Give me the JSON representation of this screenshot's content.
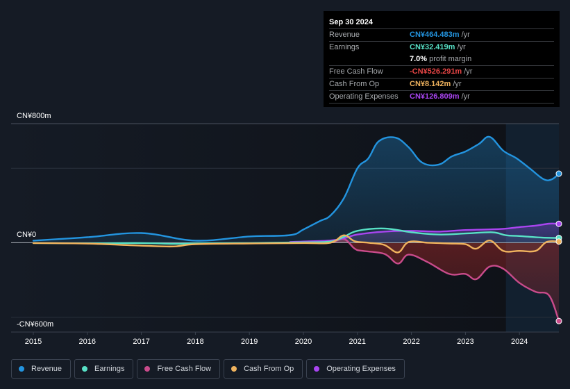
{
  "tooltip": {
    "date": "Sep 30 2024",
    "rows": [
      {
        "label": "Revenue",
        "value": "CN¥464.483m",
        "unit": "/yr",
        "color": "#2394df"
      },
      {
        "label": "Earnings",
        "value": "CN¥32.419m",
        "unit": "/yr",
        "color": "#58e1c6"
      },
      {
        "label": "",
        "value": "7.0%",
        "unit": "profit margin",
        "color": "#ffffff"
      },
      {
        "label": "Free Cash Flow",
        "value": "-CN¥526.291m",
        "unit": "/yr",
        "color": "#e64545"
      },
      {
        "label": "Cash From Op",
        "value": "CN¥8.142m",
        "unit": "/yr",
        "color": "#f0b35e"
      },
      {
        "label": "Operating Expenses",
        "value": "CN¥126.809m",
        "unit": "/yr",
        "color": "#a945f0"
      }
    ]
  },
  "legend": [
    {
      "label": "Revenue",
      "color": "#2394df"
    },
    {
      "label": "Earnings",
      "color": "#58e1c6"
    },
    {
      "label": "Free Cash Flow",
      "color": "#c94b8b"
    },
    {
      "label": "Cash From Op",
      "color": "#f0b35e"
    },
    {
      "label": "Operating Expenses",
      "color": "#a945f0"
    }
  ],
  "chart_data": {
    "type": "area",
    "title": "",
    "xlabel": "",
    "ylabel": "",
    "ylim": [
      -600,
      800
    ],
    "xlim": [
      2014.7,
      2024.75
    ],
    "y_tick_labels": [
      {
        "value": 800,
        "label": "CN¥800m"
      },
      {
        "value": 0,
        "label": "CN¥0"
      },
      {
        "value": -600,
        "label": "-CN¥600m"
      }
    ],
    "gridlines": [
      800,
      500,
      0,
      -500
    ],
    "x_ticks": [
      2015,
      2016,
      2017,
      2018,
      2019,
      2020,
      2021,
      2022,
      2023,
      2024
    ],
    "forecast_shade_start": 2023.75,
    "grid": true,
    "legend_position": "bottom-left",
    "series": [
      {
        "name": "Revenue",
        "color": "#2394df",
        "x": [
          2015.0,
          2016.0,
          2017.0,
          2018.0,
          2019.0,
          2019.75,
          2020.0,
          2020.3,
          2020.5,
          2020.75,
          2021.0,
          2021.2,
          2021.4,
          2021.7,
          2021.95,
          2022.2,
          2022.5,
          2022.75,
          2023.0,
          2023.25,
          2023.45,
          2023.7,
          2023.95,
          2024.2,
          2024.45,
          2024.6,
          2024.73
        ],
        "values": [
          14,
          37,
          65,
          14,
          42,
          51,
          89,
          145,
          182,
          299,
          500,
          566,
          683,
          706,
          641,
          538,
          524,
          580,
          613,
          664,
          711,
          618,
          566,
          496,
          426,
          426,
          464
        ]
      },
      {
        "name": "Earnings",
        "color": "#58e1c6",
        "x": [
          2015.0,
          2016.0,
          2017.0,
          2017.6,
          2018.0,
          2019.0,
          2020.0,
          2020.5,
          2020.75,
          2021.0,
          2021.5,
          2022.0,
          2022.5,
          2023.0,
          2023.5,
          2023.75,
          2024.0,
          2024.4,
          2024.73
        ],
        "values": [
          -2,
          -4,
          -2,
          -8,
          -4,
          -2,
          3,
          8,
          40,
          80,
          96,
          70,
          55,
          62,
          70,
          50,
          45,
          35,
          32
        ]
      },
      {
        "name": "Free Cash Flow",
        "color": "#c94b8b",
        "x": [
          2019.75,
          2020.0,
          2020.5,
          2020.75,
          2020.95,
          2021.1,
          2021.5,
          2021.75,
          2021.95,
          2022.3,
          2022.7,
          2023.0,
          2023.2,
          2023.45,
          2023.7,
          2024.0,
          2024.3,
          2024.55,
          2024.73
        ],
        "values": [
          0,
          0,
          2,
          25,
          -40,
          -55,
          -75,
          -140,
          -80,
          -130,
          -210,
          -210,
          -245,
          -160,
          -175,
          -270,
          -330,
          -355,
          -526
        ]
      },
      {
        "name": "Cash From Op",
        "color": "#f0b35e",
        "x": [
          2015.0,
          2016.0,
          2017.0,
          2017.6,
          2018.0,
          2019.0,
          2020.0,
          2020.5,
          2020.75,
          2020.95,
          2021.2,
          2021.5,
          2021.75,
          2021.95,
          2022.3,
          2022.7,
          2023.0,
          2023.2,
          2023.45,
          2023.7,
          2024.0,
          2024.3,
          2024.5,
          2024.73
        ],
        "values": [
          -2,
          -6,
          -20,
          -25,
          -10,
          -5,
          -2,
          0,
          50,
          10,
          0,
          -15,
          -65,
          5,
          0,
          -5,
          -10,
          -40,
          15,
          -55,
          -55,
          -55,
          5,
          8
        ]
      },
      {
        "name": "Operating Expenses",
        "color": "#a945f0",
        "x": [
          2019.75,
          2020.0,
          2020.5,
          2020.75,
          2021.0,
          2021.5,
          2022.0,
          2022.5,
          2023.0,
          2023.5,
          2023.75,
          2024.0,
          2024.3,
          2024.55,
          2024.73
        ],
        "values": [
          5,
          8,
          15,
          30,
          55,
          75,
          80,
          75,
          85,
          90,
          95,
          105,
          115,
          128,
          127
        ]
      }
    ]
  }
}
